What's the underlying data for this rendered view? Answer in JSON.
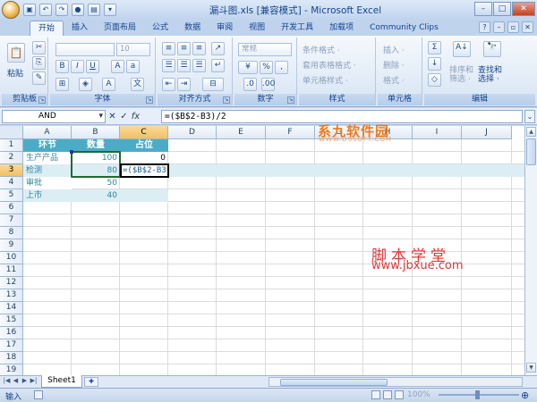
{
  "window": {
    "title": "漏斗图.xls  [兼容模式] - Microsoft Excel"
  },
  "ribbon_tabs": [
    "开始",
    "插入",
    "页面布局",
    "公式",
    "数据",
    "审阅",
    "视图",
    "开发工具",
    "加载项",
    "Community Clips"
  ],
  "groups": {
    "clipboard": {
      "label": "剪贴板",
      "paste": "粘贴"
    },
    "font": {
      "label": "字体",
      "size": "10"
    },
    "alignment": {
      "label": "对齐方式"
    },
    "number": {
      "label": "数字",
      "format": "常规"
    },
    "styles": {
      "label": "样式",
      "items": [
        "条件格式 ·",
        "套用表格格式 ·",
        "单元格样式 ·"
      ]
    },
    "cells": {
      "label": "单元格",
      "items": [
        "插入 ·",
        "删除 ·",
        "格式 ·"
      ]
    },
    "editing": {
      "label": "编辑",
      "sort": "排序和\n筛选 ·",
      "find": "查找和\n选择 ·"
    }
  },
  "formula_bar": {
    "name_box": "AND",
    "formula": "=($B$2-B3)/2"
  },
  "columns": [
    "A",
    "B",
    "C",
    "D",
    "E",
    "F",
    "G",
    "H",
    "I",
    "J"
  ],
  "rows": [
    "1",
    "2",
    "3",
    "4",
    "5",
    "6",
    "7",
    "8",
    "9",
    "10",
    "11",
    "12",
    "13",
    "14",
    "15",
    "16",
    "17",
    "18",
    "19"
  ],
  "cells": {
    "headers": [
      "环节",
      "数量",
      "占位"
    ],
    "data": [
      {
        "label": "生产产品",
        "qty": "100",
        "pos": "0"
      },
      {
        "label": "检测",
        "qty": "80",
        "pos": "=($B$2-B3)/2"
      },
      {
        "label": "审批",
        "qty": "50",
        "pos": ""
      },
      {
        "label": "上市",
        "qty": "40",
        "pos": ""
      }
    ]
  },
  "watermarks": {
    "line1": "脚本学堂",
    "line2": "www.jbxue.com",
    "top1": "系九软件园",
    "top2": "WWW.D9SOFT.COM"
  },
  "sheet_tabs": [
    "Sheet1"
  ],
  "status": {
    "mode": "输入",
    "zoom": "100%"
  },
  "colors": {
    "header_fill": "#4bacc6",
    "band_fill": "#dbeef4",
    "text_teal": "#31849b"
  }
}
